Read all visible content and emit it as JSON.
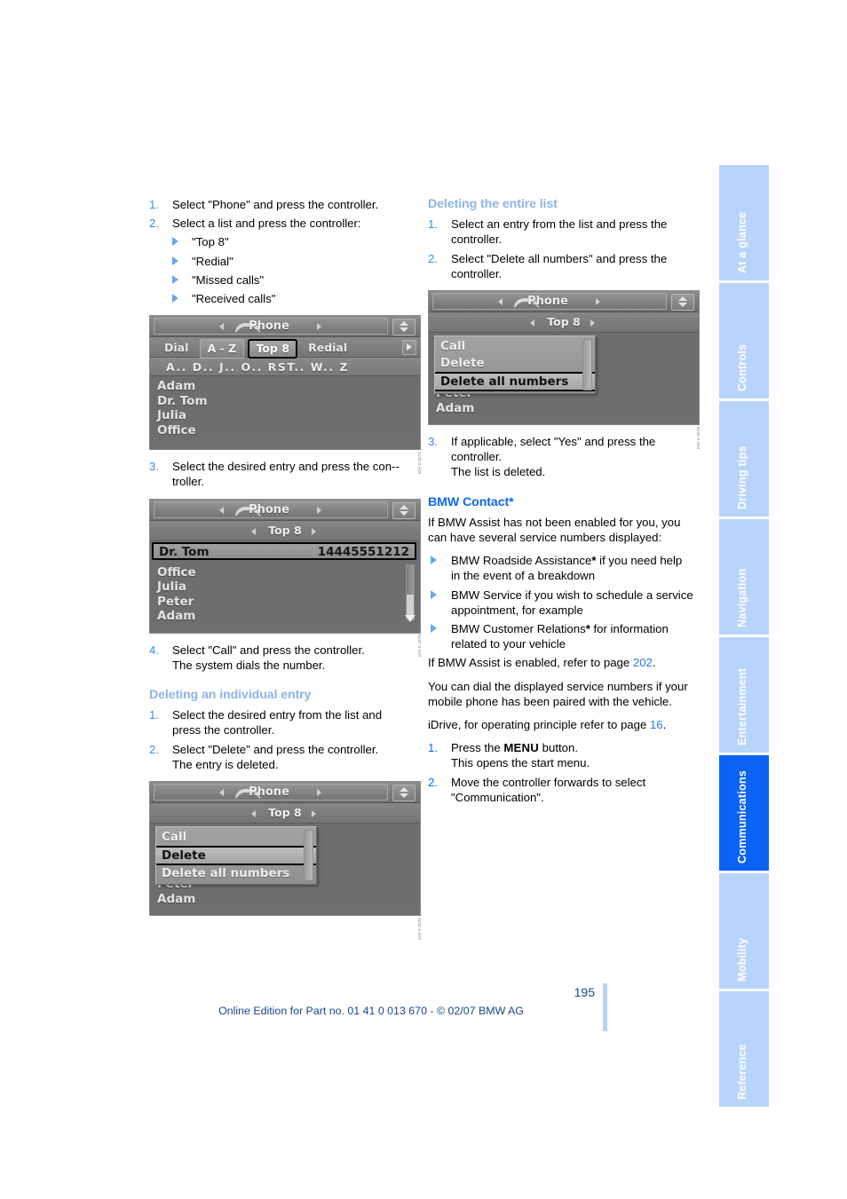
{
  "document": {
    "page_number": "195",
    "footer_text": "Online Edition for Part no. 01 41 0 013 670 - © 02/07 BMW AG"
  },
  "sidebar": {
    "tabs": [
      {
        "label": "At a glance",
        "active": false
      },
      {
        "label": "Controls",
        "active": false
      },
      {
        "label": "Driving tips",
        "active": false
      },
      {
        "label": "Navigation",
        "active": false
      },
      {
        "label": "Entertainment",
        "active": false
      },
      {
        "label": "Communications",
        "active": true
      },
      {
        "label": "Mobility",
        "active": false
      },
      {
        "label": "Reference",
        "active": false
      }
    ],
    "colors": {
      "inactive": "#b9d4fb",
      "active": "#0b63f6",
      "text": "#ffffff"
    }
  },
  "left_column": {
    "steps_top": [
      {
        "num": "1.",
        "text": "Select \"Phone\" and press the controller."
      },
      {
        "num": "2.",
        "text": "Select a list and press the controller:"
      }
    ],
    "list_options": [
      "\"Top 8\"",
      "\"Redial\"",
      "\"Missed calls\"",
      "\"Received calls\""
    ],
    "step_3": {
      "num": "3.",
      "text": "Select the desired entry and press the con-­troller."
    },
    "step_4": {
      "num": "4.",
      "line1": "Select \"Call\" and press the controller.",
      "line2": "The system dials the number."
    },
    "heading_delete_individual": "Deleting an individual entry",
    "delete_individual_steps": [
      {
        "num": "1.",
        "line1": "Select the desired entry from the list and",
        "line2": "press the controller."
      },
      {
        "num": "2.",
        "line1": "Select \"Delete\" and press the controller.",
        "line2": "The entry is deleted."
      }
    ]
  },
  "right_column": {
    "heading_delete_list": "Deleting the entire list",
    "delete_list_steps": [
      {
        "num": "1.",
        "line1": "Select an entry from the list and press the",
        "line2": "controller."
      },
      {
        "num": "2.",
        "line1": "Select \"Delete all numbers\" and press the",
        "line2": "controller."
      }
    ],
    "step_3": {
      "num": "3.",
      "line1": "If applicable, select \"Yes\" and press the",
      "line2": "controller.",
      "line3": "The list is deleted."
    },
    "heading_bmw_contact": "BMW Contact*",
    "intro": "If BMW Assist has not been enabled for you, you can have several service numbers dis­played:",
    "services": [
      {
        "name": "BMW Roadside Assistance",
        "star": "*",
        "rest": " if you need help in the event of a breakdown"
      },
      {
        "name": "BMW Service",
        "star": "",
        "rest": " if you wish to schedule a ser­vice appointment, for example"
      },
      {
        "name": "BMW Customer Relations",
        "star": "*",
        "rest": " for information related to your vehicle"
      }
    ],
    "assist_enabled_pre": "If BMW Assist is enabled, refer to page ",
    "assist_enabled_page": "202",
    "assist_enabled_post": ".",
    "dial_note": "You can dial the displayed service numbers if your mobile phone has been paired with the vehicle.",
    "idrive_note_pre": "iDrive, for operating principle refer to page ",
    "idrive_note_page": "16",
    "idrive_note_post": ".",
    "menu_steps": [
      {
        "num": "1.",
        "pre": "Press the ",
        "btn": "MENU",
        "post": " button.",
        "line2": "This opens the start menu."
      },
      {
        "num": "2.",
        "line1": "Move the controller forwards to select",
        "line2": "\"Communication\"."
      }
    ]
  },
  "screens": {
    "phone_az": {
      "title": "Phone",
      "tabs": [
        "Dial",
        "A - Z",
        "Top 8",
        "Redial"
      ],
      "selected_tab": "Top 8",
      "letters": "A.. D.. J.. O.. RST.. W.. Z",
      "entries": [
        "Adam",
        "Dr. Tom",
        "Julia",
        "Office"
      ],
      "figcode": "IOH 0 4072 NJ"
    },
    "top8_detail": {
      "title": "Phone",
      "subtitle": "Top 8",
      "highlight_name": "Dr. Tom",
      "highlight_number": "14445551212",
      "entries": [
        "Office",
        "Julia",
        "Peter",
        "Adam"
      ],
      "figcode": "IOH 0 4079 NJ"
    },
    "popup_delete": {
      "title": "Phone",
      "subtitle": "Top 8",
      "menu_items": [
        "Call",
        "Delete",
        "Delete all numbers"
      ],
      "selected_item": "Delete",
      "background_entries": [
        "Peter",
        "Adam"
      ],
      "figcode": "IOH 0 4075 NJ"
    },
    "popup_delete_all": {
      "title": "Phone",
      "subtitle": "Top 8",
      "menu_items": [
        "Call",
        "Delete",
        "Delete all numbers"
      ],
      "selected_item": "Delete all numbers",
      "background_entries": [
        "Peter",
        "Adam"
      ],
      "figcode": "IOH 0 4076 NJ"
    }
  }
}
